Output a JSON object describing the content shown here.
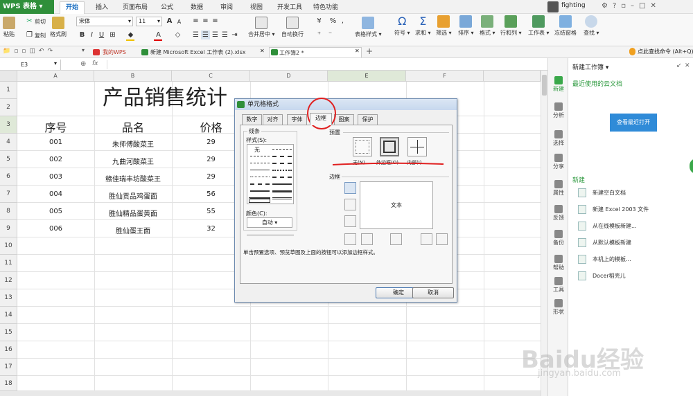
{
  "app": {
    "wps_label": "WPS 表格",
    "user": "fighting"
  },
  "menu_tabs": [
    "开始",
    "插入",
    "页面布局",
    "公式",
    "数据",
    "审阅",
    "视图",
    "开发工具",
    "特色功能"
  ],
  "ribbon": {
    "paste": "粘贴",
    "cut": "剪切",
    "copy": "复制",
    "format_painter": "格式刷",
    "font": "宋体",
    "font_size": "11",
    "merge": "合并居中",
    "wrap": "自动换行",
    "table_style": "表格样式",
    "symbol": "符号",
    "sum": "求和",
    "filter": "筛选",
    "sort": "排序",
    "format": "格式",
    "rowcol": "行和列",
    "worksheet": "工作表",
    "freeze": "冻结窗格",
    "find": "查找"
  },
  "doc_tabs": [
    "我的WPS",
    "新建 Microsoft Excel 工作表 (2).xlsx",
    "工作簿2 *"
  ],
  "search_hint": "点此查找命令 (Alt+Q)",
  "formula_bar": {
    "cell_ref": "E3",
    "fx": "fx"
  },
  "columns": [
    "A",
    "B",
    "C",
    "D",
    "E",
    "F"
  ],
  "rows": [
    "1",
    "2",
    "3",
    "4",
    "5",
    "6",
    "7",
    "8",
    "9",
    "10",
    "11",
    "12",
    "13",
    "14",
    "15",
    "16",
    "17",
    "18"
  ],
  "sheet": {
    "title": "产品销售统计",
    "headers": [
      "序号",
      "品名",
      "价格"
    ],
    "data": [
      [
        "001",
        "朱师傅酸菜王",
        "29"
      ],
      [
        "002",
        "九曲河酸菜王",
        "29"
      ],
      [
        "003",
        "赣佳瑞丰坊酸菜王",
        "29"
      ],
      [
        "004",
        "胜仙贡品鸡蛋面",
        "56"
      ],
      [
        "005",
        "胜仙精品蛋黄面",
        "55"
      ],
      [
        "006",
        "胜仙蛋王面",
        "32"
      ]
    ]
  },
  "right_strip": [
    "新建",
    "分析",
    "选择",
    "分享",
    "属性",
    "反馈",
    "备份",
    "帮助",
    "工具",
    "形状"
  ],
  "task_pane": {
    "title": "新建工作簿",
    "recent_cloud": "最近使用的云文档",
    "view_recent": "查看最近打开",
    "new_section": "新建",
    "items": [
      "新建空白文档",
      "新建 Excel 2003 文件",
      "从在线模板新建...",
      "从默认模板新建",
      "本机上的模板...",
      "Docer稻壳儿"
    ]
  },
  "dialog": {
    "title": "单元格格式",
    "tabs": [
      "数字",
      "对齐",
      "字体",
      "边框",
      "图案",
      "保护"
    ],
    "line_group": "线条",
    "style_label": "样式(S):",
    "none_label": "无",
    "color_label": "颜色(C):",
    "color_value": "自动",
    "preset_label": "预置",
    "preset_none": "无(N)",
    "preset_outline": "外边框(O)",
    "preset_inside": "内部(I)",
    "border_label": "边框",
    "preview_text": "文本",
    "hint": "单击预置选项、预览草图及上面的按钮可以添加边框样式。",
    "ok": "确定",
    "cancel": "取消"
  },
  "watermark": {
    "text": "Baidu经验",
    "url": "jingyan.baidu.com"
  },
  "colors": {
    "accent": "#2f8f3a",
    "tab_blue": "#1b6fc2",
    "annotation_red": "#e02020",
    "task_green": "#2e9a3f",
    "view_btn": "#2f8bd8"
  }
}
